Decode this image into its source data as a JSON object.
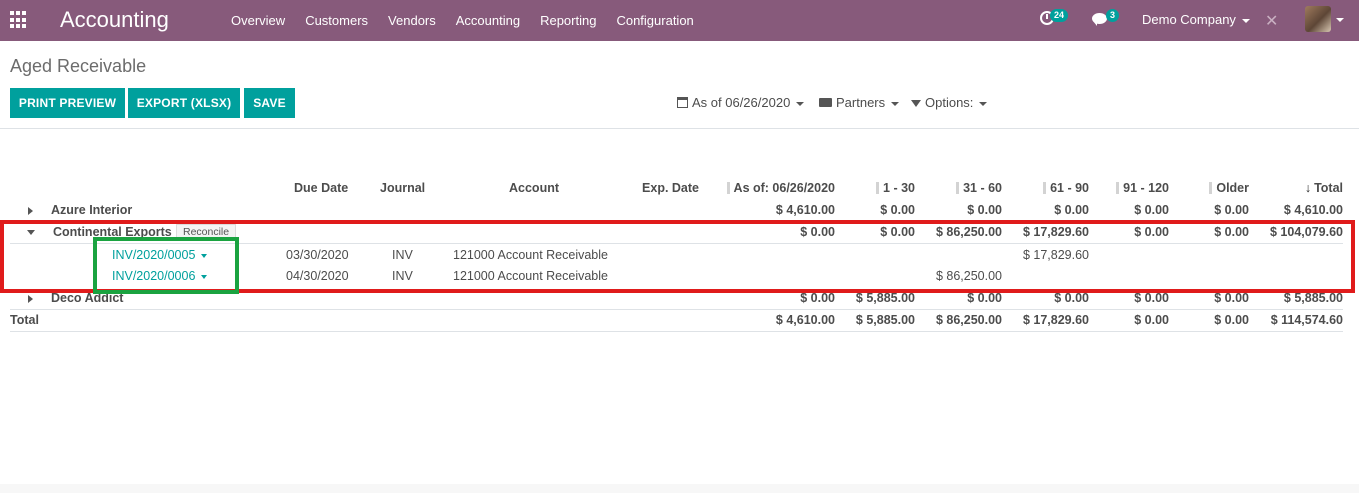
{
  "navbar": {
    "app_title": "Accounting",
    "menu": [
      "Overview",
      "Customers",
      "Vendors",
      "Accounting",
      "Reporting",
      "Configuration"
    ],
    "activity_count": "24",
    "messages_count": "3",
    "company": "Demo Company",
    "colors": {
      "brand": "#875a7b",
      "badge": "#00a09d"
    }
  },
  "control_panel": {
    "breadcrumb": "Aged Receivable",
    "buttons": {
      "print_preview": "PRINT PREVIEW",
      "export": "EXPORT (XLSX)",
      "save": "SAVE"
    },
    "filters": {
      "date": "As of 06/26/2020",
      "partners": "Partners",
      "options": "Options:"
    },
    "colors": {
      "primary_button": "#00a09d"
    }
  },
  "report": {
    "columns": {
      "due_date": "Due Date",
      "journal": "Journal",
      "account": "Account",
      "exp_date": "Exp. Date",
      "as_of": "As of: 06/26/2020",
      "d1_30": "1 - 30",
      "d31_60": "31 - 60",
      "d61_90": "61 - 90",
      "d91_120": "91 - 120",
      "older": "Older",
      "total": "Total"
    },
    "partners": [
      {
        "name": "Azure Interior",
        "expanded": false,
        "values": [
          "$ 4,610.00",
          "$ 0.00",
          "$ 0.00",
          "$ 0.00",
          "$ 0.00",
          "$ 0.00",
          "$ 4,610.00"
        ]
      },
      {
        "name": "Continental Exports",
        "expanded": true,
        "reconcile_label": "Reconcile",
        "values": [
          "$ 0.00",
          "$ 0.00",
          "$ 86,250.00",
          "$ 17,829.60",
          "$ 0.00",
          "$ 0.00",
          "$ 104,079.60"
        ],
        "lines": [
          {
            "ref": "INV/2020/0005",
            "due_date": "03/30/2020",
            "journal": "INV",
            "account": "121000 Account Receivable",
            "d61_90": "$ 17,829.60"
          },
          {
            "ref": "INV/2020/0006",
            "due_date": "04/30/2020",
            "journal": "INV",
            "account": "121000 Account Receivable",
            "d31_60": "$ 86,250.00"
          }
        ]
      },
      {
        "name": "Deco Addict",
        "expanded": false,
        "values": [
          "$ 0.00",
          "$ 5,885.00",
          "$ 0.00",
          "$ 0.00",
          "$ 0.00",
          "$ 0.00",
          "$ 5,885.00"
        ]
      }
    ],
    "total": {
      "label": "Total",
      "values": [
        "$ 4,610.00",
        "$ 5,885.00",
        "$ 86,250.00",
        "$ 17,829.60",
        "$ 0.00",
        "$ 0.00",
        "$ 114,574.60"
      ]
    },
    "highlight_colors": {
      "partner_box": "#e01b1b",
      "invoice_box": "#1aa340"
    }
  }
}
